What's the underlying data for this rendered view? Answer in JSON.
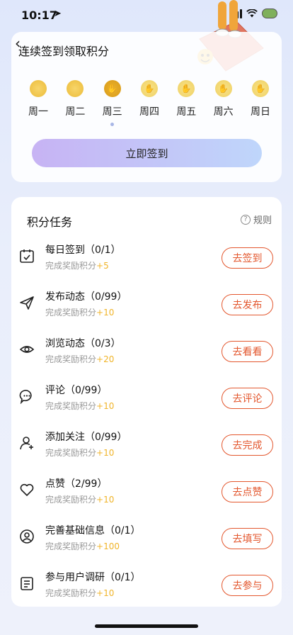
{
  "status": {
    "time": "10:17"
  },
  "checkin": {
    "title": "连续签到领取积分",
    "days": [
      {
        "label": "周一",
        "state": "done"
      },
      {
        "label": "周二",
        "state": "done"
      },
      {
        "label": "周三",
        "state": "today"
      },
      {
        "label": "周四",
        "state": "future"
      },
      {
        "label": "周五",
        "state": "future"
      },
      {
        "label": "周六",
        "state": "future"
      },
      {
        "label": "周日",
        "state": "future"
      }
    ],
    "button": "立即签到"
  },
  "tasks": {
    "title": "积分任务",
    "rules": "规则",
    "items": [
      {
        "name": "每日签到（0/1）",
        "sub": "完成奖励积分",
        "points": "+5",
        "button": "去签到",
        "icon": "calendar-check-icon"
      },
      {
        "name": "发布动态（0/99）",
        "sub": "完成奖励积分",
        "points": "+10",
        "button": "去发布",
        "icon": "send-icon"
      },
      {
        "name": "浏览动态（0/3）",
        "sub": "完成奖励积分",
        "points": "+20",
        "button": "去看看",
        "icon": "eye-icon"
      },
      {
        "name": "评论（0/99）",
        "sub": "完成奖励积分",
        "points": "+10",
        "button": "去评论",
        "icon": "comment-icon"
      },
      {
        "name": "添加关注（0/99）",
        "sub": "完成奖励积分",
        "points": "+10",
        "button": "去完成",
        "icon": "add-user-icon"
      },
      {
        "name": "点赞（2/99）",
        "sub": "完成奖励积分",
        "points": "+10",
        "button": "去点赞",
        "icon": "heart-icon"
      },
      {
        "name": "完善基础信息（0/1）",
        "sub": "完成奖励积分",
        "points": "+100",
        "button": "去填写",
        "icon": "profile-icon"
      },
      {
        "name": "参与用户调研（0/1）",
        "sub": "完成奖励积分",
        "points": "+10",
        "button": "去参与",
        "icon": "survey-icon"
      }
    ]
  },
  "colors": {
    "accent": "#e3572e",
    "points": "#f0b429"
  }
}
